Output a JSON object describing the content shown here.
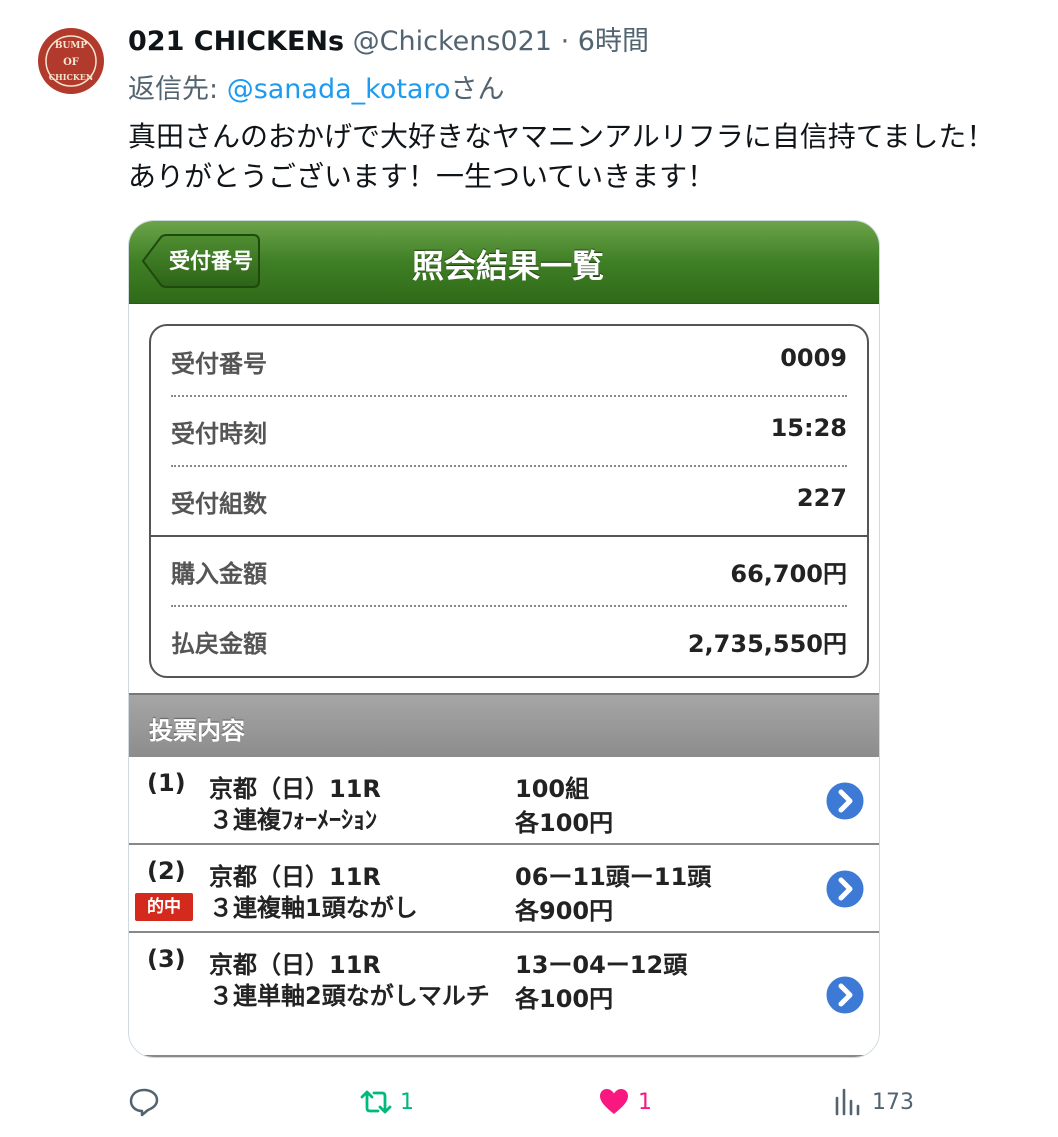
{
  "tweet": {
    "avatar_text": [
      "BUMP",
      "OF",
      "CHICKEN"
    ],
    "name": "021 CHICKENs",
    "handle": "@Chickens021",
    "separator": "·",
    "time": "6時間",
    "reply_prefix": "返信先: ",
    "reply_mention": "@sanada_kotaro",
    "reply_suffix": "さん",
    "text_line1": "真田さんのおかげで大好きなヤマニンアルリフラに自信持てました！",
    "text_line2": "ありがとうございます！一生ついていきます！"
  },
  "card": {
    "back_label": "受付番号",
    "title": "照会結果一覧",
    "summary": [
      {
        "label": "受付番号",
        "value": "0009"
      },
      {
        "label": "受付時刻",
        "value": "15:28"
      },
      {
        "label": "受付組数",
        "value": "227"
      },
      {
        "label": "購入金額",
        "value": "66,700円"
      },
      {
        "label": "払戻金額",
        "value": "2,735,550円"
      }
    ],
    "section_title": "投票内容",
    "bets": [
      {
        "num": "(1)",
        "race": "京都（日）11R",
        "type": "３連複ﾌｫｰﾒｰｼｮﾝ",
        "combo": "100組",
        "unit": "各100円",
        "hit": ""
      },
      {
        "num": "(2)",
        "race": "京都（日）11R",
        "type": "３連複軸1頭ながし",
        "combo": "06ー11頭ー11頭",
        "unit": "各900円",
        "hit": "的中"
      },
      {
        "num": "(3)",
        "race": "京都（日）11R",
        "type": "３連単軸2頭ながしマルチ",
        "combo": "13ー04ー12頭",
        "unit": "各100円",
        "hit": ""
      }
    ]
  },
  "actions": {
    "reply_count": "",
    "retweet_count": "1",
    "like_count": "1",
    "views_count": "173",
    "retweet_color": "#00ba7c",
    "like_color": "#f91880",
    "icon_color": "#536471"
  }
}
